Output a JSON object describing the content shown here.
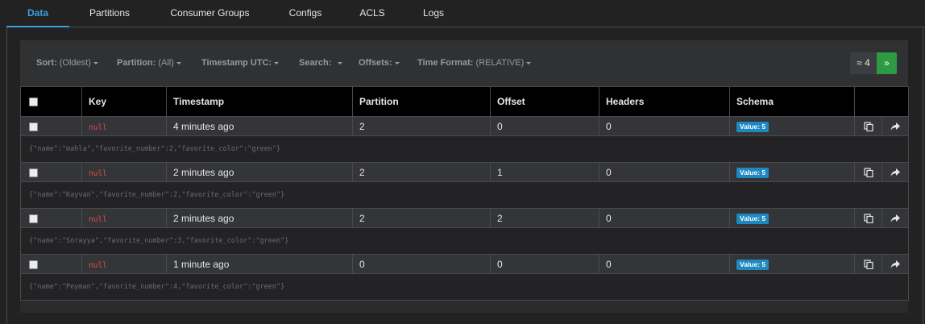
{
  "tabs": [
    {
      "label": "Data",
      "active": true
    },
    {
      "label": "Partitions"
    },
    {
      "label": "Consumer Groups"
    },
    {
      "label": "Configs"
    },
    {
      "label": "ACLS"
    },
    {
      "label": "Logs"
    }
  ],
  "filters": {
    "sort": {
      "label": "Sort:",
      "value": "(Oldest)"
    },
    "partition": {
      "label": "Partition:",
      "value": "(All)"
    },
    "timestamp": {
      "label": "Timestamp UTC:",
      "value": ""
    },
    "search": {
      "label": "Search:",
      "value": ""
    },
    "offsets": {
      "label": "Offsets:",
      "value": ""
    },
    "time_format": {
      "label": "Time Format:",
      "value": "(RELATIVE)"
    }
  },
  "pager": {
    "count": "≈ 4",
    "next": "»"
  },
  "table": {
    "headers": [
      "Key",
      "Timestamp",
      "Partition",
      "Offset",
      "Headers",
      "Schema"
    ],
    "rows": [
      {
        "key": "null",
        "timestamp": "4 minutes ago",
        "partition": "2",
        "offset": "0",
        "headers": "0",
        "schema": "Value: 5",
        "payload": "{\"name\":\"mahla\",\"favorite_number\":2,\"favorite_color\":\"green\"}"
      },
      {
        "key": "null",
        "timestamp": "2 minutes ago",
        "partition": "2",
        "offset": "1",
        "headers": "0",
        "schema": "Value: 5",
        "payload": "{\"name\":\"Kayvan\",\"favorite_number\":2,\"favorite_color\":\"green\"}"
      },
      {
        "key": "null",
        "timestamp": "2 minutes ago",
        "partition": "2",
        "offset": "2",
        "headers": "0",
        "schema": "Value: 5",
        "payload": "{\"name\":\"Sorayya\",\"favorite_number\":3,\"favorite_color\":\"green\"}"
      },
      {
        "key": "null",
        "timestamp": "1 minute ago",
        "partition": "0",
        "offset": "0",
        "headers": "0",
        "schema": "Value: 5",
        "payload": "{\"name\":\"Peyman\",\"favorite_number\":4,\"favorite_color\":\"green\"}"
      }
    ]
  },
  "icons": {
    "copy": "copy-icon",
    "share": "share-icon"
  },
  "colors": {
    "accent": "#3a9fd6",
    "next_button": "#2f9a44",
    "null_key": "#e04b4b",
    "badge": "#1f88c0"
  }
}
